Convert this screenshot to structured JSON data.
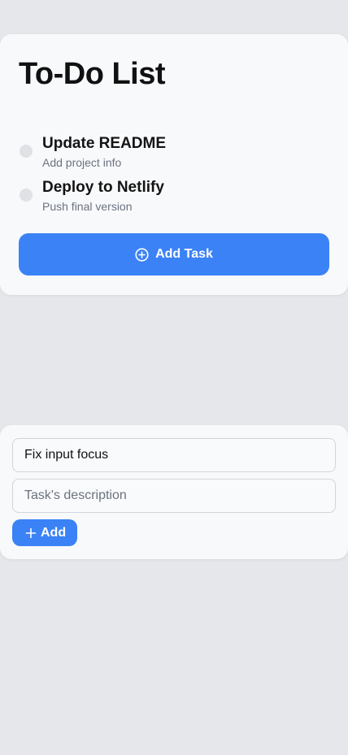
{
  "header": {
    "title": "To-Do List"
  },
  "tasks": [
    {
      "title": "Update README",
      "description": "Add project info",
      "completed": false
    },
    {
      "title": "Deploy to Netlify",
      "description": "Push final version",
      "completed": false
    }
  ],
  "add_task_button": {
    "label": "Add Task",
    "icon": "plus-circle-icon"
  },
  "form": {
    "title_input": {
      "value": "Fix input focus",
      "placeholder": ""
    },
    "description_input": {
      "value": "",
      "placeholder": "Task's description"
    },
    "add_button": {
      "label": "Add",
      "icon": "plus-icon"
    }
  },
  "colors": {
    "background": "#e5e7eb",
    "card": "#f8f9fb",
    "accent": "#3b82f6",
    "checkbox": "#e0e1e4"
  }
}
